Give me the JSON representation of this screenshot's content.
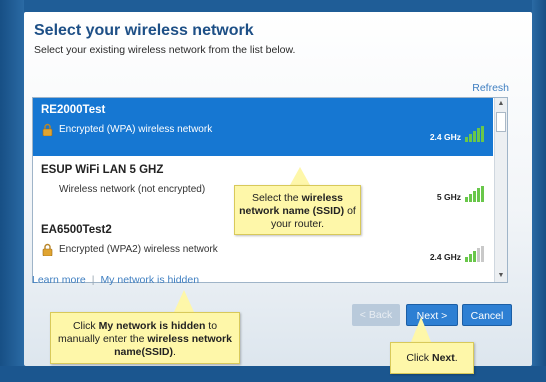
{
  "dialog": {
    "title": "Select your wireless network",
    "subtitle": "Select your existing wireless network from the list below.",
    "refresh": "Refresh"
  },
  "networks": [
    {
      "name": "RE2000Test",
      "desc": "Encrypted (WPA) wireless network",
      "freq": "2.4 GHz",
      "locked": true,
      "selected": true,
      "signal": 4
    },
    {
      "name": "ESUP WiFi LAN 5 GHZ",
      "desc": "Wireless network (not encrypted)",
      "freq": "5 GHz",
      "locked": false,
      "selected": false,
      "signal": 4
    },
    {
      "name": "EA6500Test2",
      "desc": "Encrypted (WPA2) wireless network",
      "freq": "2.4 GHz",
      "locked": true,
      "selected": false,
      "signal": 3
    }
  ],
  "links": {
    "learn_more": "Learn more",
    "hidden": "My network is hidden"
  },
  "buttons": {
    "back": "< Back",
    "next": "Next >",
    "cancel": "Cancel"
  },
  "callouts": {
    "ssid": {
      "prefix": "Select the ",
      "bold": "wireless network name (SSID)",
      "suffix": " of your router."
    },
    "hidden": {
      "prefix": "Click ",
      "bold1": "My network is hidden",
      "mid": " to manually enter the ",
      "bold2": "wireless network name(SSID)",
      "suffix": "."
    },
    "next": {
      "prefix": "Click ",
      "bold": "Next",
      "suffix": "."
    }
  },
  "colors": {
    "selected_row": "#1677d2",
    "signal_on": "#69c74a",
    "callout_bg": "#fef7a9",
    "frame": "#1f5d97"
  }
}
